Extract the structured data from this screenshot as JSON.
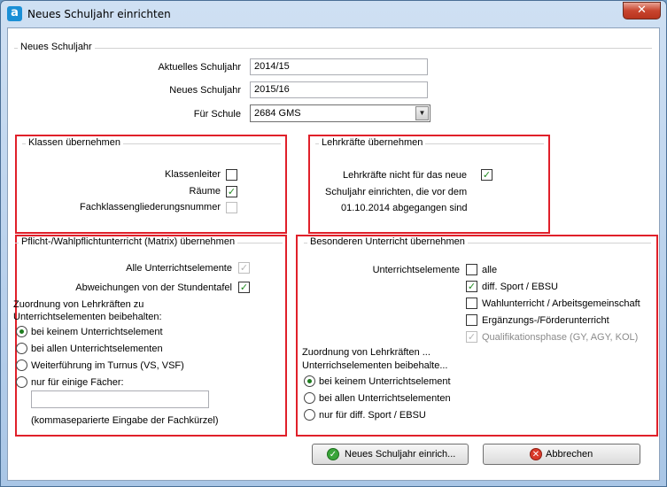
{
  "window": {
    "title": "Neues Schuljahr einrichten",
    "app_icon": "a",
    "close_symbol": "✕"
  },
  "neues_schuljahr": {
    "title": "Neues Schuljahr",
    "aktuelles_label": "Aktuelles Schuljahr",
    "aktuelles_value": "2014/15",
    "neues_label": "Neues Schuljahr",
    "neues_value": "2015/16",
    "schule_label": "Für Schule",
    "schule_value": "2684 GMS"
  },
  "klassen": {
    "title": "Klassen übernehmen",
    "klassenleiter_label": "Klassenleiter",
    "klassenleiter_checked": false,
    "raeume_label": "Räume",
    "raeume_checked": true,
    "fachklassen_label": "Fachklassengliederungsnummer",
    "fachklassen_checked": false
  },
  "lehrkraefte": {
    "title": "Lehrkräfte übernehmen",
    "line1": "Lehrkräfte nicht für das neue",
    "line2": "Schuljahr einrichten, die vor dem",
    "line3": "01.10.2014 abgegangen sind",
    "checked": true
  },
  "pflicht": {
    "title": "Pflicht-/Wahlpflichtunterricht (Matrix) übernehmen",
    "alle_label": "Alle Unterrichtselemente",
    "alle_checked": true,
    "abweichungen_label": "Abweichungen von der Stundentafel",
    "abweichungen_checked": true,
    "zuordnung_line1": "Zuordnung von Lehrkräften zu",
    "zuordnung_line2": "Unterrichtselementen beibehalten:",
    "radio1": "bei keinem Unterrichtselement",
    "radio2": "bei allen Unterrichtselementen",
    "radio3": "Weiterführung im Turnus (VS, VSF)",
    "radio4": "nur für einige Fächer:",
    "faecher_value": "",
    "hint": "(kommaseparierte Eingabe der Fachkürzel)"
  },
  "besonderer": {
    "title": "Besonderen Unterricht übernehmen",
    "elements_label": "Unterrichtselemente",
    "options": [
      {
        "label": "alle",
        "checked": false
      },
      {
        "label": "diff. Sport / EBSU",
        "checked": true
      },
      {
        "label": "Wahlunterricht / Arbeitsgemeinschaft",
        "checked": false
      },
      {
        "label": "Ergänzungs-/Förderunterricht",
        "checked": false
      },
      {
        "label": "Qualifikationsphase (GY, AGY, KOL)",
        "checked": true
      }
    ],
    "zuordnung_line1": "Zuordnung von Lehrkräften ...",
    "zuordnung_line2": "Unterrichselementen beibehalte...",
    "radio1": "bei keinem Unterrichtselement",
    "radio2": "bei allen Unterrichtselementen",
    "radio3": "nur für diff. Sport / EBSU"
  },
  "buttons": {
    "ok_label": "Neues Schuljahr einrich...",
    "cancel_label": "Abbrechen"
  },
  "colors": {
    "highlight_frame": "#e0202a",
    "check_green": "#1f8a1f"
  }
}
